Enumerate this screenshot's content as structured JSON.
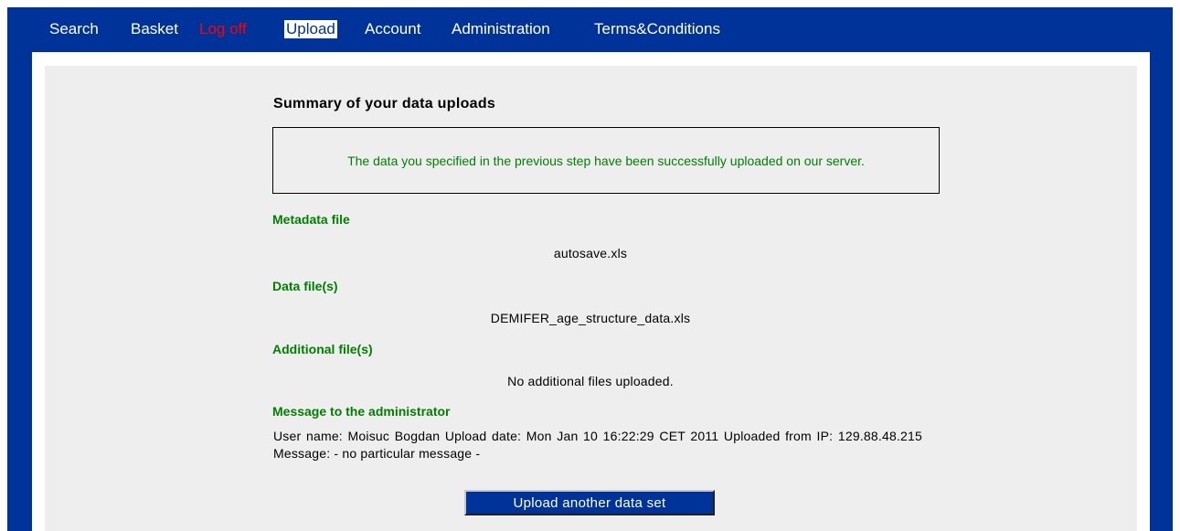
{
  "nav": {
    "items": [
      {
        "label": "Search"
      },
      {
        "label": "Basket"
      },
      {
        "label": "Log off"
      },
      {
        "label": "Upload"
      },
      {
        "label": "Account"
      },
      {
        "label": "Administration"
      },
      {
        "label": "Terms&Conditions"
      }
    ],
    "active": "Upload"
  },
  "summary": {
    "title": "Summary of your data uploads",
    "success_message": "The data you specified in the previous step have been successfully uploaded on our server.",
    "metadata_heading": "Metadata file",
    "metadata_file": "autosave.xls",
    "data_heading": "Data file(s)",
    "data_file": "DEMIFER_age_structure_data.xls",
    "additional_heading": "Additional file(s)",
    "additional_files": "No additional files uploaded.",
    "message_heading": "Message to the administrator",
    "message_text": "User name: Moisuc Bogdan Upload date: Mon Jan 10 16:22:29 CET 2011 Uploaded from IP: 129.88.48.215 Message: - no particular message -"
  },
  "actions": {
    "upload_another_label": "Upload another data set"
  },
  "colors": {
    "brand_blue": "#003399",
    "panel_gray": "#eeeeee",
    "heading_green": "#008000",
    "logoff_red": "#ff0000"
  }
}
